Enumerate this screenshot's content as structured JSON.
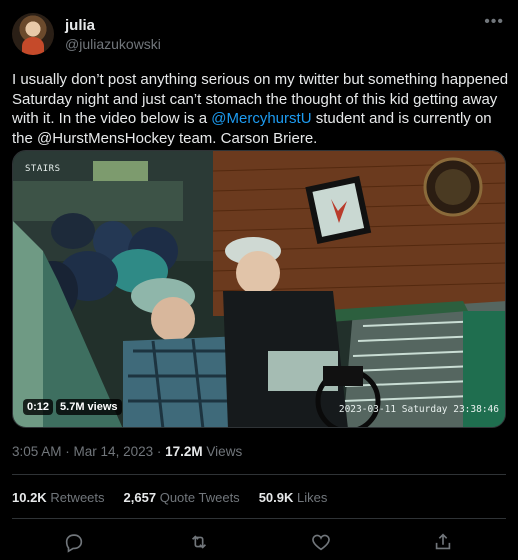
{
  "author": {
    "name": "julia",
    "handle": "@juliazukowski"
  },
  "more_icon": "•••",
  "tweet": {
    "part1": "I usually don’t post anything serious on my twitter but something happened Saturday night and just can’t stomach the thought of this kid getting away with it. In the video below is a ",
    "mention1": "@MercyhurstU",
    "part2": " student and is currently on the @HurstMensHockey team. Carson Briere."
  },
  "media": {
    "camera_label": "STAIRS",
    "timestamp": "2023-03-11 Saturday 23:38:46",
    "duration": "0:12",
    "views": "5.7M views"
  },
  "meta": {
    "time": "3:05 AM",
    "date": "Mar 14, 2023",
    "views_count": "17.2M",
    "views_label": "Views"
  },
  "stats": {
    "retweets_count": "10.2K",
    "retweets_label": "Retweets",
    "quotes_count": "2,657",
    "quotes_label": "Quote Tweets",
    "likes_count": "50.9K",
    "likes_label": "Likes"
  },
  "actions": [
    "reply-icon",
    "retweet-icon",
    "like-icon",
    "share-icon"
  ],
  "colors": {
    "background": "#000000",
    "text": "#e7e9ea",
    "secondary": "#71767b",
    "link": "#1d9bf0",
    "border": "#2f3336"
  }
}
